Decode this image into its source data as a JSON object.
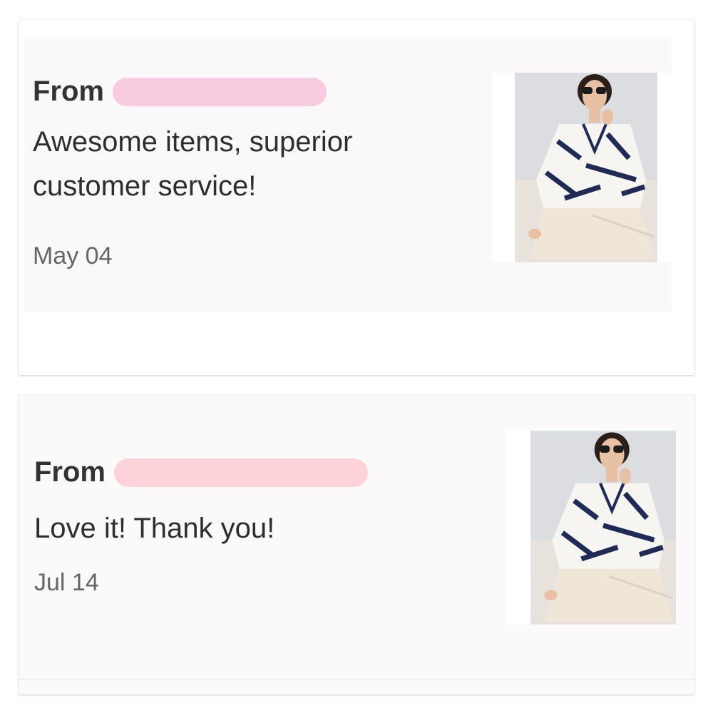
{
  "reviews": [
    {
      "from_label": "From",
      "message": "Awesome items, superior customer service!",
      "date": "May 04",
      "thumbnail_icon": "product-photo-icon",
      "redaction_color": "#f8cbe0"
    },
    {
      "from_label": "From",
      "message": "Love it! Thank you!",
      "date": "Jul 14",
      "thumbnail_icon": "product-photo-icon",
      "redaction_color": "#fdd3d9"
    }
  ],
  "colors": {
    "card_background": "#faf8f9",
    "text_primary": "#333333",
    "text_secondary": "#666666",
    "blouse_stripe": "#1f2a55",
    "pants": "#efe6d8"
  }
}
